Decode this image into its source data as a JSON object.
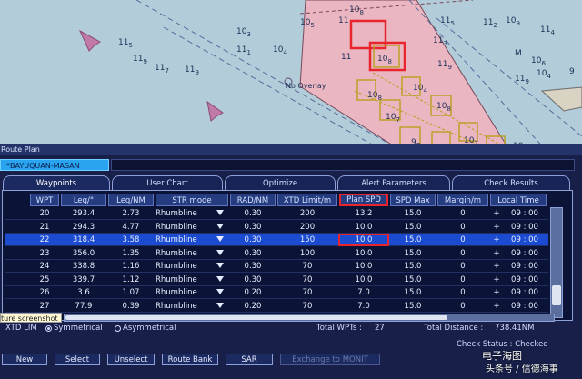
{
  "chart": {
    "overlay_label": "No Overlay",
    "depths": [
      {
        "t": "11",
        "s": "9"
      },
      {
        "t": "11",
        "s": "5"
      },
      {
        "t": "11",
        "s": "7"
      },
      {
        "t": "11",
        "s": "9"
      },
      {
        "t": "11",
        "s": "1"
      },
      {
        "t": "10",
        "s": "4"
      },
      {
        "t": "10",
        "s": "3"
      },
      {
        "t": "10",
        "s": "5"
      },
      {
        "t": "11",
        "s": ""
      },
      {
        "t": "10",
        "s": "8"
      },
      {
        "t": "11",
        "s": ""
      },
      {
        "t": "10",
        "s": "8"
      },
      {
        "t": "10",
        "s": "8"
      },
      {
        "t": "10",
        "s": "4"
      },
      {
        "t": "10",
        "s": "7"
      },
      {
        "t": "10",
        "s": "8"
      },
      {
        "t": "9",
        "s": "7"
      },
      {
        "t": "10",
        "s": "7"
      },
      {
        "t": "10",
        "s": "8"
      },
      {
        "t": "11",
        "s": "3"
      },
      {
        "t": "11",
        "s": "9"
      },
      {
        "t": "11",
        "s": "5"
      },
      {
        "t": "11",
        "s": "2"
      },
      {
        "t": "10",
        "s": "9"
      },
      {
        "t": "11",
        "s": "4"
      },
      {
        "t": "10",
        "s": "6"
      },
      {
        "t": "11",
        "s": "9"
      },
      {
        "t": "10",
        "s": "4"
      },
      {
        "t": "9",
        "s": ""
      },
      {
        "t": "M",
        "s": ""
      }
    ]
  },
  "window": {
    "title": "Route Plan",
    "route_name": "*BAYUQUAN-MASAN"
  },
  "tabs": [
    "Waypoints",
    "User Chart",
    "Optimize",
    "Alert Parameters",
    "Check Results"
  ],
  "table": {
    "headers": [
      "WPT",
      "Leg/°",
      "Leg/NM",
      "STR mode",
      "RAD/NM",
      "XTD Limit/m",
      "Plan SPD",
      "SPD Max",
      "Margin/m",
      "Local Time"
    ],
    "rows": [
      {
        "wpt": "20",
        "leg_deg": "293.4",
        "leg_nm": "2.73",
        "str": "Rhumbline",
        "rad": "0.30",
        "xtd": "200",
        "plan": "13.2",
        "max": "15.0",
        "margin": "0",
        "sign": "+",
        "time": "09 : 00"
      },
      {
        "wpt": "21",
        "leg_deg": "294.3",
        "leg_nm": "4.77",
        "str": "Rhumbline",
        "rad": "0.30",
        "xtd": "200",
        "plan": "10.0",
        "max": "15.0",
        "margin": "0",
        "sign": "+",
        "time": "09 : 00"
      },
      {
        "wpt": "22",
        "leg_deg": "318.4",
        "leg_nm": "3.58",
        "str": "Rhumbline",
        "rad": "0.30",
        "xtd": "150",
        "plan": "10.0",
        "max": "15.0",
        "margin": "0",
        "sign": "+",
        "time": "09 : 00"
      },
      {
        "wpt": "23",
        "leg_deg": "356.0",
        "leg_nm": "1.35",
        "str": "Rhumbline",
        "rad": "0.30",
        "xtd": "100",
        "plan": "10.0",
        "max": "15.0",
        "margin": "0",
        "sign": "+",
        "time": "09 : 00"
      },
      {
        "wpt": "24",
        "leg_deg": "338.8",
        "leg_nm": "1.16",
        "str": "Rhumbline",
        "rad": "0.30",
        "xtd": "70",
        "plan": "10.0",
        "max": "15.0",
        "margin": "0",
        "sign": "+",
        "time": "09 : 00"
      },
      {
        "wpt": "25",
        "leg_deg": "339.7",
        "leg_nm": "1.12",
        "str": "Rhumbline",
        "rad": "0.30",
        "xtd": "70",
        "plan": "10.0",
        "max": "15.0",
        "margin": "0",
        "sign": "+",
        "time": "09 : 00"
      },
      {
        "wpt": "26",
        "leg_deg": "3.6",
        "leg_nm": "1.07",
        "str": "Rhumbline",
        "rad": "0.20",
        "xtd": "70",
        "plan": "7.0",
        "max": "15.0",
        "margin": "0",
        "sign": "+",
        "time": "09 : 00"
      },
      {
        "wpt": "27",
        "leg_deg": "77.9",
        "leg_nm": "0.39",
        "str": "Rhumbline",
        "rad": "0.20",
        "xtd": "70",
        "plan": "7.0",
        "max": "15.0",
        "margin": "0",
        "sign": "+",
        "time": "09 : 00"
      }
    ]
  },
  "tooltip": "ture screenshot",
  "footer": {
    "xtd_lim": "XTD LIM",
    "symmetrical": "Symmetrical",
    "asymmetrical": "Asymmetrical",
    "total_wpts_label": "Total WPTs :",
    "total_wpts": "27",
    "total_distance_label": "Total Distance :",
    "total_distance": "738.41NM",
    "check_status": "Check Status : Checked"
  },
  "buttons": [
    "New",
    "Select",
    "Unselect",
    "Route Bank",
    "SAR",
    "Exchange to MONIT"
  ],
  "watermark": {
    "logo_text": "电子海图",
    "source_text": "头条号 / 信德海事"
  }
}
